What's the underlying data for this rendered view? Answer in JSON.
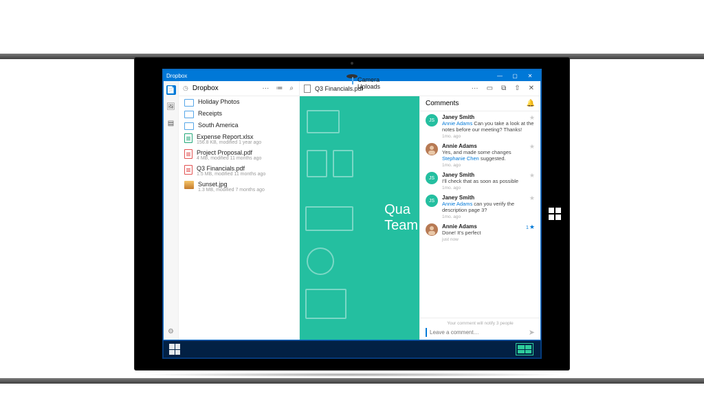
{
  "window": {
    "app_title": "Dropbox",
    "controls": {
      "min": "—",
      "max": "▢",
      "close": "✕"
    }
  },
  "iconbar": {
    "items": [
      "files",
      "photos",
      "paper"
    ],
    "active_index": 0
  },
  "files_panel": {
    "header": {
      "title": "Dropbox",
      "more": "···",
      "list_icon": "≔",
      "search_icon": "⌕"
    },
    "folders": [
      {
        "name": "Camera Uploads",
        "kind": "camera"
      },
      {
        "name": "Holiday Photos",
        "kind": "folder"
      },
      {
        "name": "Receipts",
        "kind": "folder"
      },
      {
        "name": "South America",
        "kind": "folder"
      }
    ],
    "files": [
      {
        "name": "Expense Report.xlsx",
        "meta": "156.8 KB, modified 1 year ago",
        "icon": "green"
      },
      {
        "name": "Project Proposal.pdf",
        "meta": "4 MB, modified 11 months ago",
        "icon": "red"
      },
      {
        "name": "Q3 Financials.pdf",
        "meta": "1.5 MB, modified 11 months ago",
        "icon": "red"
      },
      {
        "name": "Sunset.jpg",
        "meta": "1.3 MB, modified 7 months ago",
        "icon": "thumb"
      }
    ]
  },
  "preview": {
    "title": "Q3 Financials.pdf",
    "toolbar": {
      "more": "···",
      "comment": "▭",
      "copy": "⧉",
      "share": "⇧",
      "close": "✕"
    },
    "doc_text_line1": "Qua",
    "doc_text_line2": "Team"
  },
  "comments": {
    "title": "Comments",
    "notify_text": "Your comment will notify 3 people",
    "input_placeholder": "Leave a comment…",
    "items": [
      {
        "author": "Janey Smith",
        "avatar": "js",
        "text_prefix": "",
        "mention": "Annie Adams",
        "text_suffix": " Can you take a look at the notes before our meeting? Thanks!",
        "time": "1mo. ago",
        "star_count": "",
        "star_style": ""
      },
      {
        "author": "Annie Adams",
        "avatar": "aa",
        "text_prefix": "Yes, and made some changes ",
        "mention": "Stephanie Chen",
        "text_suffix": " suggested.",
        "time": "1mo. ago",
        "star_count": "",
        "star_style": ""
      },
      {
        "author": "Janey Smith",
        "avatar": "js",
        "text_prefix": "I'll check that as soon as possible",
        "mention": "",
        "text_suffix": "",
        "time": "1mo. ago",
        "star_count": "",
        "star_style": ""
      },
      {
        "author": "Janey Smith",
        "avatar": "js",
        "text_prefix": "",
        "mention": "Annie Adams",
        "text_suffix": " can you verify the description page 3?",
        "time": "1mo. ago",
        "star_count": "",
        "star_style": ""
      },
      {
        "author": "Annie Adams",
        "avatar": "aa",
        "text_prefix": "Done! It's perfect",
        "mention": "",
        "text_suffix": "",
        "time": "just now",
        "star_count": "1",
        "star_style": "blue"
      }
    ]
  }
}
